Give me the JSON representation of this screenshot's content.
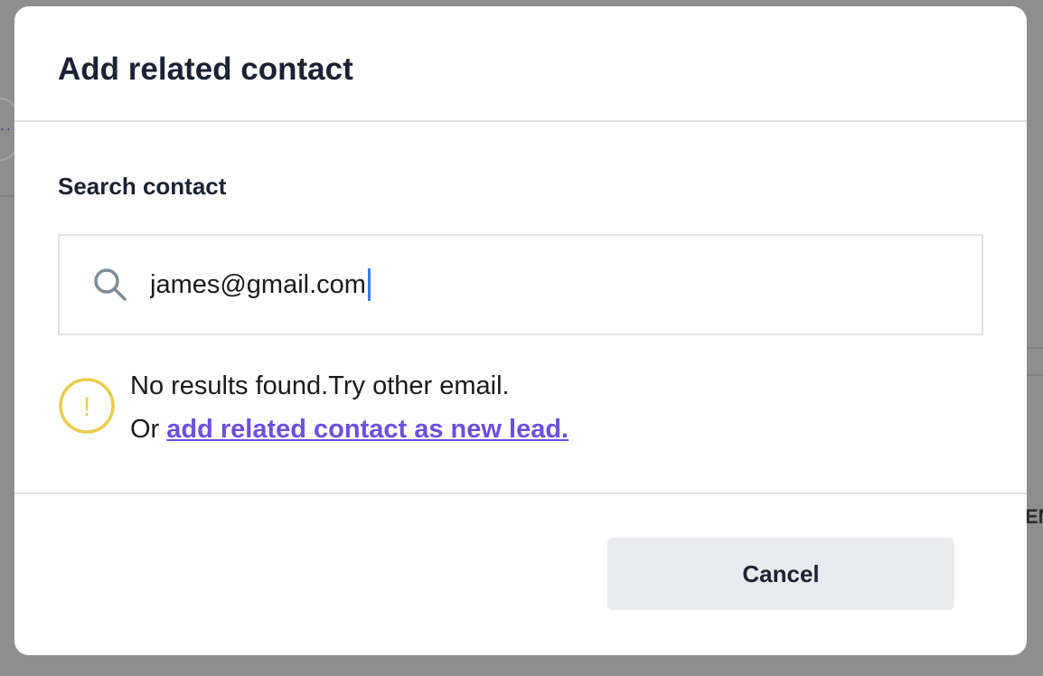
{
  "modal": {
    "title": "Add related contact",
    "search": {
      "label": "Search contact",
      "value": "james@gmail.com",
      "icon": "search-icon"
    },
    "warning": {
      "icon": "exclamation-circle-icon",
      "icon_glyph": "!",
      "message": "No results found.Try other email.",
      "prefix": "Or",
      "link_text": "add related contact as new lead.",
      "icon_color": "#e8cc4a",
      "link_color": "#6b4fe0"
    },
    "footer": {
      "cancel_label": "Cancel"
    }
  },
  "background": {
    "left_dots": "..",
    "right_fragment": "EN"
  }
}
